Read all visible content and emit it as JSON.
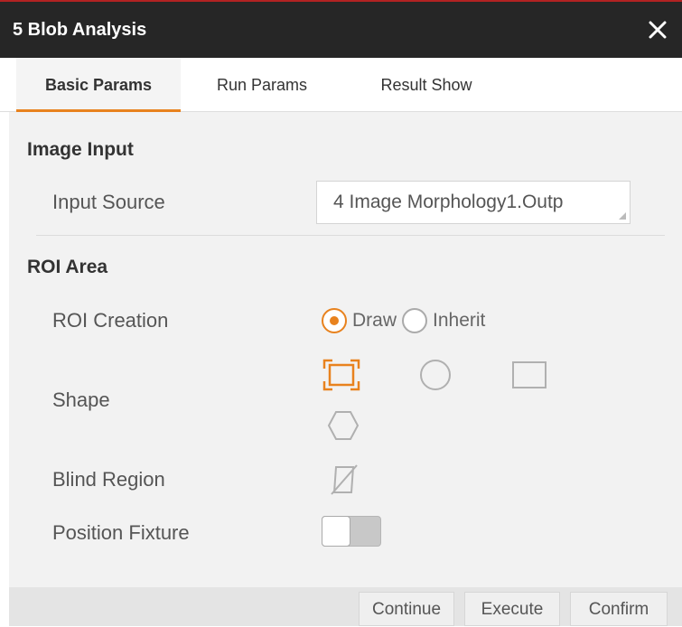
{
  "window": {
    "title": "5 Blob Analysis"
  },
  "tabs": [
    {
      "label": "Basic Params",
      "active": true
    },
    {
      "label": "Run Params",
      "active": false
    },
    {
      "label": "Result Show",
      "active": false
    }
  ],
  "image_input": {
    "section_title": "Image Input",
    "input_source_label": "Input Source",
    "input_source_value": "4 Image Morphology1.Outp"
  },
  "roi_area": {
    "section_title": "ROI Area",
    "roi_creation_label": "ROI Creation",
    "roi_options": [
      {
        "label": "Draw",
        "selected": true
      },
      {
        "label": "Inherit",
        "selected": false
      }
    ],
    "shape_label": "Shape",
    "shapes": [
      "full-image-rectangle",
      "circle",
      "rectangle",
      "polygon"
    ],
    "selected_shape": "full-image-rectangle",
    "blind_region_label": "Blind Region",
    "position_fixture_label": "Position Fixture",
    "position_fixture_enabled": false
  },
  "footer": {
    "continue_label": "Continue",
    "execute_label": "Execute",
    "confirm_label": "Confirm"
  },
  "colors": {
    "accent": "#e8821e",
    "titlebar": "#262626",
    "panel": "#f2f2f2"
  }
}
